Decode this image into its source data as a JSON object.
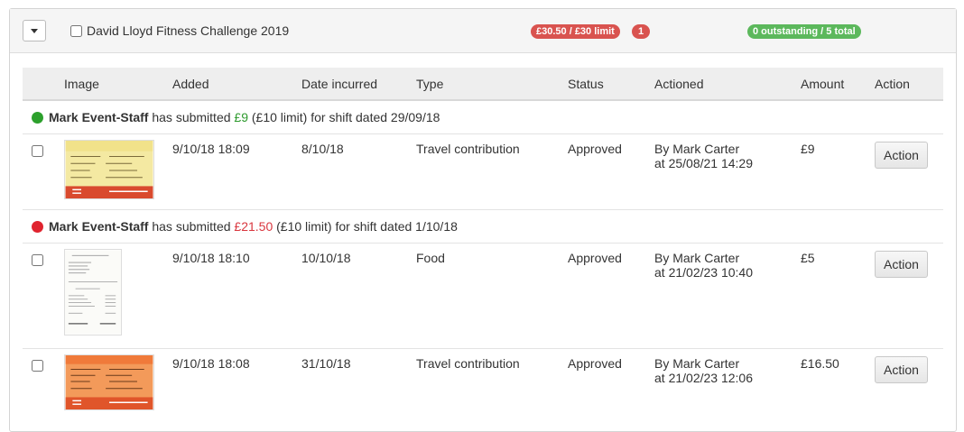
{
  "header": {
    "title": "David Lloyd Fitness Challenge 2019",
    "limit_badge": "£30.50 / £30 limit",
    "count_badge": "1",
    "outstanding_badge": "0 outstanding / 5 total"
  },
  "columns": [
    "Image",
    "Added",
    "Date incurred",
    "Type",
    "Status",
    "Actioned",
    "Amount",
    "Action"
  ],
  "groups": [
    {
      "status_color": "green",
      "name": "Mark Event-Staff",
      "text1": " has submitted ",
      "amount": "£9",
      "text2": " (£10 limit) for shift dated 29/09/18",
      "rows": [
        {
          "image": "train-ticket-icon",
          "added": "9/10/18 18:09",
          "date_incurred": "8/10/18",
          "type": "Travel contribution",
          "status": "Approved",
          "actioned_by": "By Mark Carter",
          "actioned_at": "at 25/08/21 14:29",
          "amount": "£9",
          "action_label": "Action"
        }
      ]
    },
    {
      "status_color": "red",
      "name": "Mark Event-Staff",
      "text1": " has submitted ",
      "amount": "£21.50",
      "text2": " (£10 limit) for shift dated 1/10/18",
      "rows": [
        {
          "image": "receipt-icon",
          "added": "9/10/18 18:10",
          "date_incurred": "10/10/18",
          "type": "Food",
          "status": "Approved",
          "actioned_by": "By Mark Carter",
          "actioned_at": "at 21/02/23 10:40",
          "amount": "£5",
          "action_label": "Action"
        },
        {
          "image": "train-ticket-icon",
          "added": "9/10/18 18:08",
          "date_incurred": "31/10/18",
          "type": "Travel contribution",
          "status": "Approved",
          "actioned_by": "By Mark Carter",
          "actioned_at": "at 21/02/23 12:06",
          "amount": "£16.50",
          "action_label": "Action"
        }
      ]
    }
  ],
  "colors": {
    "badge_red": "#d9534f",
    "badge_green": "#5cb85c",
    "amount_green": "#2e9a2e",
    "amount_red": "#d9363e"
  }
}
